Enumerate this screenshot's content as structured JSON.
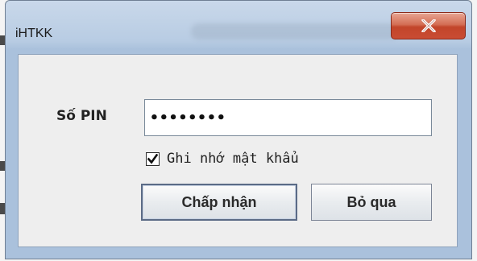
{
  "window": {
    "title": "iHTKK"
  },
  "form": {
    "pin_label": "Số PIN",
    "pin_value": "••••••••",
    "remember_label": "Ghi nhớ mật khẩu",
    "remember_checked": true
  },
  "buttons": {
    "accept_label": "Chấp nhận",
    "cancel_label": "Bỏ qua"
  },
  "icons": {
    "close": "close-x-icon",
    "check": "checkmark-icon"
  },
  "colors": {
    "titlebar": "#b8cce3",
    "close_button": "#c94c33",
    "content_bg": "#eeeeee"
  }
}
